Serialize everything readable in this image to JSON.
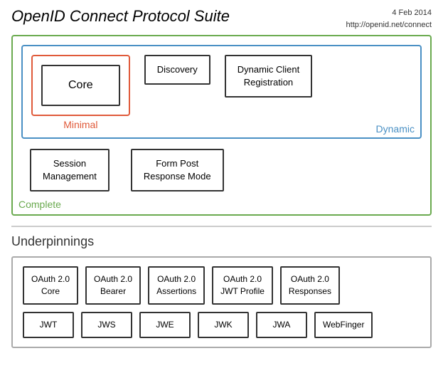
{
  "header": {
    "title": "OpenID Connect Protocol Suite",
    "date": "4 Feb 2014",
    "url": "http://openid.net/connect"
  },
  "complete": {
    "label": "Complete",
    "dynamic": {
      "label": "Dynamic",
      "minimal": {
        "label": "Minimal",
        "core_label": "Core"
      },
      "discovery_label": "Discovery",
      "dcr_line1": "Dynamic Client",
      "dcr_line2": "Registration"
    },
    "session_line1": "Session",
    "session_line2": "Management",
    "form_post_line1": "Form Post",
    "form_post_line2": "Response Mode"
  },
  "underpinnings": {
    "title": "Underpinnings",
    "row1": [
      {
        "label": "OAuth 2.0\nCore"
      },
      {
        "label": "OAuth 2.0\nBearer"
      },
      {
        "label": "OAuth 2.0\nAssertions"
      },
      {
        "label": "OAuth 2.0\nJWT Profile"
      },
      {
        "label": "OAuth 2.0\nResponses"
      }
    ],
    "row2": [
      {
        "label": "JWT"
      },
      {
        "label": "JWS"
      },
      {
        "label": "JWE"
      },
      {
        "label": "JWK"
      },
      {
        "label": "JWA"
      },
      {
        "label": "WebFinger"
      }
    ]
  }
}
